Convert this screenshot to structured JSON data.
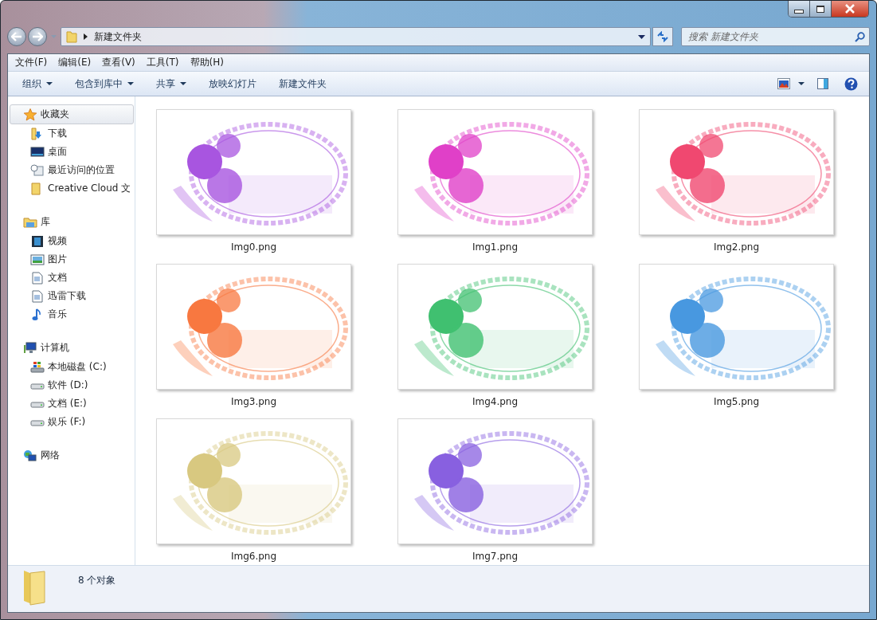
{
  "address": {
    "path": "新建文件夹"
  },
  "search": {
    "placeholder": "搜索 新建文件夹"
  },
  "menu": [
    "文件(F)",
    "编辑(E)",
    "查看(V)",
    "工具(T)",
    "帮助(H)"
  ],
  "commands": [
    {
      "label": "组织",
      "dropdown": true
    },
    {
      "label": "包含到库中",
      "dropdown": true
    },
    {
      "label": "共享",
      "dropdown": true
    },
    {
      "label": "放映幻灯片",
      "dropdown": false
    },
    {
      "label": "新建文件夹",
      "dropdown": false
    }
  ],
  "sidebar": [
    {
      "label": "收藏夹",
      "selected": true,
      "children": [
        {
          "label": "下载",
          "selected": false
        },
        {
          "label": "桌面",
          "selected": false
        },
        {
          "label": "最近访问的位置",
          "selected": false
        },
        {
          "label": "Creative Cloud 文",
          "selected": false
        }
      ]
    },
    {
      "label": "库",
      "selected": false,
      "children": [
        {
          "label": "视频",
          "selected": false
        },
        {
          "label": "图片",
          "selected": false
        },
        {
          "label": "文档",
          "selected": false
        },
        {
          "label": "迅雷下载",
          "selected": false
        },
        {
          "label": "音乐",
          "selected": false
        }
      ]
    },
    {
      "label": "计算机",
      "selected": false,
      "children": [
        {
          "label": "本地磁盘 (C:)",
          "selected": false
        },
        {
          "label": "软件 (D:)",
          "selected": false
        },
        {
          "label": "文档 (E:)",
          "selected": false
        },
        {
          "label": "娱乐 (F:)",
          "selected": false
        }
      ]
    },
    {
      "label": "网络",
      "selected": false
    }
  ],
  "files": [
    {
      "name": "Img0.png",
      "color": "#a855e0"
    },
    {
      "name": "Img1.png",
      "color": "#e040c8"
    },
    {
      "name": "Img2.png",
      "color": "#f04870"
    },
    {
      "name": "Img3.png",
      "color": "#f87840"
    },
    {
      "name": "Img4.png",
      "color": "#40c070"
    },
    {
      "name": "Img5.png",
      "color": "#4898e0"
    },
    {
      "name": "Img6.png",
      "color": "#d8c880"
    },
    {
      "name": "Img7.png",
      "color": "#8860e0"
    }
  ],
  "status_bar": {
    "count": "8 个对象"
  }
}
